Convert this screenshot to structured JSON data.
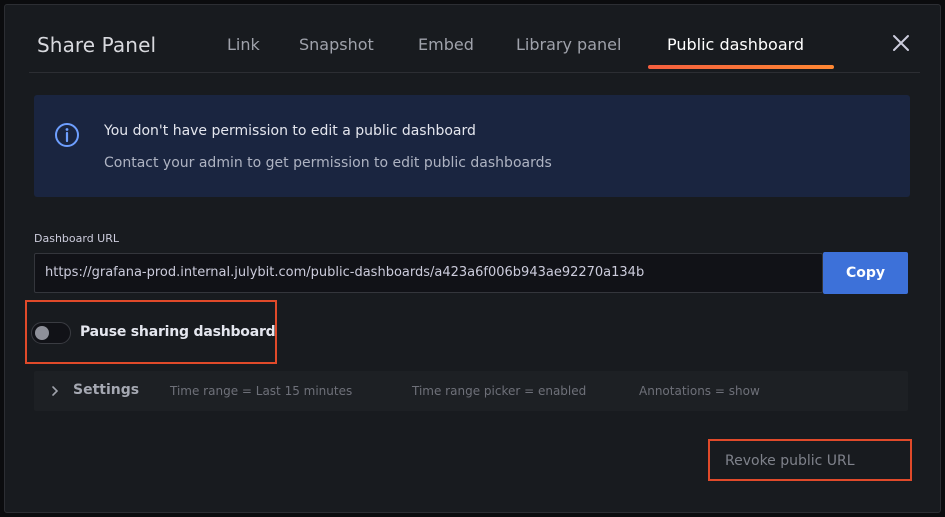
{
  "modal": {
    "title": "Share Panel",
    "tabs": [
      {
        "label": "Link"
      },
      {
        "label": "Snapshot"
      },
      {
        "label": "Embed"
      },
      {
        "label": "Library panel"
      },
      {
        "label": "Public dashboard",
        "active": true
      }
    ],
    "close_icon": "close-icon"
  },
  "info": {
    "icon": "info-icon",
    "title": "You don't have permission to edit a public dashboard",
    "text": "Contact your admin to get permission to edit public dashboards"
  },
  "url": {
    "label": "Dashboard URL",
    "value": "https://grafana-prod.internal.julybit.com/public-dashboards/a423a6f006b943ae92270a134b",
    "copy_label": "Copy"
  },
  "pause": {
    "label": "Pause sharing dashboard",
    "enabled": false
  },
  "settings": {
    "label": "Settings",
    "items": [
      "Time range = Last 15 minutes",
      "Time range picker = enabled",
      "Annotations = show"
    ]
  },
  "revoke": {
    "label": "Revoke public URL"
  },
  "colors": {
    "accent": "#3d71d9",
    "tab_underline": "#f55f3e",
    "highlight": "#e04a2a",
    "info_bg": "#1a2540"
  }
}
